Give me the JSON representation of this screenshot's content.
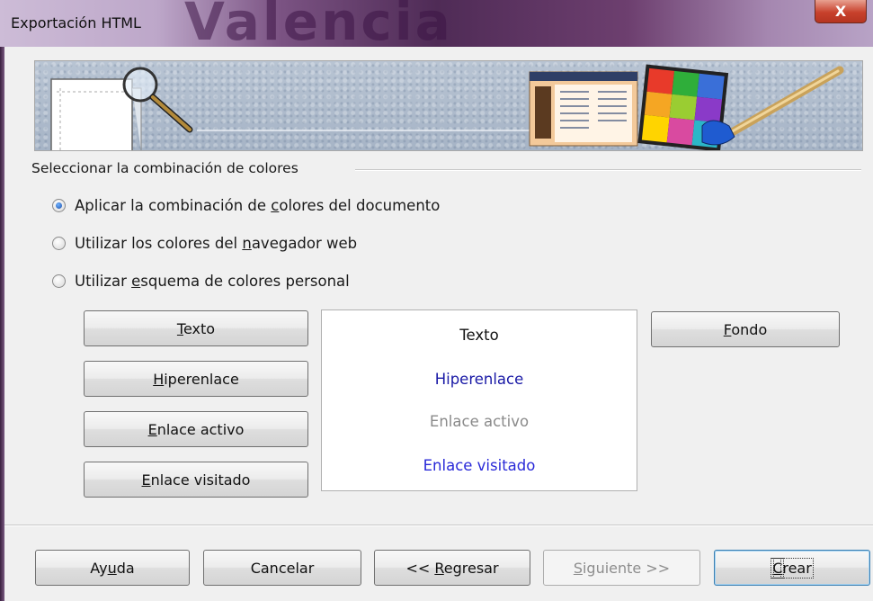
{
  "window": {
    "title": "Exportación HTML",
    "background_word": "Valencia",
    "close_glyph": "X"
  },
  "group": {
    "label": "Seleccionar la combinación de colores"
  },
  "radios": [
    {
      "pre": "Aplicar la combinación de ",
      "key": "c",
      "post": "olores del documento",
      "checked": true
    },
    {
      "pre": "Utilizar los colores del ",
      "key": "n",
      "post": "avegador web",
      "checked": false
    },
    {
      "pre": "Utilizar ",
      "key": "e",
      "post": "squema de colores personal",
      "checked": false
    }
  ],
  "color_buttons": {
    "text": {
      "key": "T",
      "rest": "exto"
    },
    "link": {
      "key": "H",
      "rest": "iperenlace"
    },
    "active": {
      "key": "E",
      "rest": "nlace activo"
    },
    "visited": {
      "key": "E",
      "rest": "nlace visitado"
    },
    "background": {
      "key": "F",
      "rest": "ondo"
    }
  },
  "preview": {
    "text": "Texto",
    "link": "Hiperenlace",
    "active": "Enlace activo",
    "visited": "Enlace visitado"
  },
  "footer": {
    "help": {
      "pre": "Ay",
      "key": "u",
      "post": "da"
    },
    "cancel": "Cancelar",
    "back": {
      "pre": "<< ",
      "key": "R",
      "post": "egresar"
    },
    "next": {
      "pre": "",
      "key": "S",
      "post": "iguiente >>"
    },
    "create": {
      "pre": "",
      "key": "C",
      "post": "rear"
    }
  },
  "colors": {
    "link": "#1a1aa6",
    "active_link": "#8a8a8a",
    "visited_link": "#2929d8",
    "text": "#111111"
  },
  "icons": {
    "banner": [
      "page-outline-icon",
      "magnifier-icon",
      "web-page-icon",
      "color-palette-icon",
      "paintbrush-icon"
    ],
    "radio_selected": "radio-selected",
    "close": "close-icon"
  }
}
